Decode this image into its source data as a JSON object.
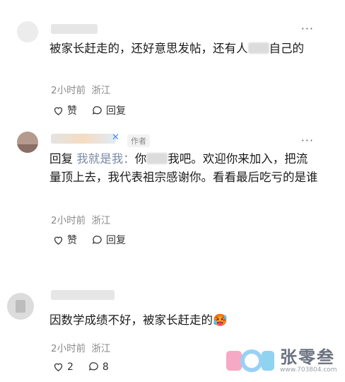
{
  "comments": [
    {
      "text_before": "被家长赶走的，还好意思发帖，还有人",
      "text_after": "自己的",
      "time": "2小时前",
      "location": "浙江",
      "like_label": "赞",
      "reply_label": "回复",
      "more": "···"
    },
    {
      "author_tag": "作者",
      "reply_prefix": "回复",
      "reply_target": "我就是我：",
      "text_before": "你",
      "text_after": "我吧。欢迎你来加入，把流量顶上去，我代表祖宗感谢你。看看最后吃亏的是谁",
      "time": "2小时前",
      "location": "浙江",
      "like_label": "赞",
      "reply_label": "回复",
      "more": "···"
    },
    {
      "text": "因数学成绩不好，被家长赶走的",
      "emoji": "🥵",
      "time": "2小时前",
      "location": "浙江",
      "like_count": "2",
      "reply_count": "8",
      "more": "···"
    }
  ],
  "watermark": {
    "brand": "张零叁",
    "url": "www.703804.com"
  }
}
